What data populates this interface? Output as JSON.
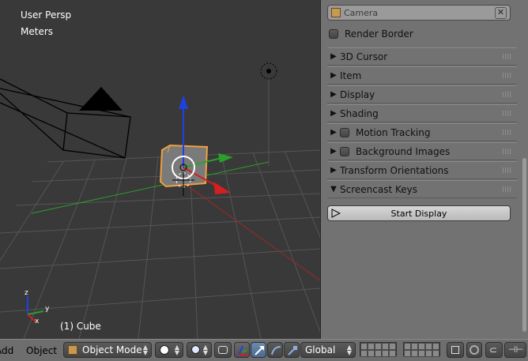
{
  "viewport": {
    "view_name": "User Persp",
    "units": "Meters",
    "object_info": "(1) Cube",
    "axis_labels": {
      "x": "x",
      "y": "y",
      "z": "z"
    }
  },
  "sidebar": {
    "camera_field": {
      "value": "Camera",
      "icon": "camera-cube-icon"
    },
    "render_border_label": "Render Border",
    "panels": [
      {
        "label": "3D Cursor",
        "expanded": false,
        "checkbox": false
      },
      {
        "label": "Item",
        "expanded": false,
        "checkbox": false
      },
      {
        "label": "Display",
        "expanded": false,
        "checkbox": false
      },
      {
        "label": "Shading",
        "expanded": false,
        "checkbox": false
      },
      {
        "label": "Motion Tracking",
        "expanded": false,
        "checkbox": true
      },
      {
        "label": "Background Images",
        "expanded": false,
        "checkbox": true
      },
      {
        "label": "Transform Orientations",
        "expanded": false,
        "checkbox": false
      },
      {
        "label": "Screencast Keys",
        "expanded": true,
        "checkbox": false
      }
    ],
    "start_display_label": "Start Display"
  },
  "header": {
    "add_label": "Add",
    "object_label": "Object",
    "mode_label": "Object Mode",
    "orientation_label": "Global"
  },
  "colors": {
    "viewport_bg": "#393939",
    "sidebar_bg": "#727272",
    "header_bg": "#6e6e6e",
    "selection_orange": "#f0a040",
    "axis_x": "#d02020",
    "axis_y": "#2aa02a",
    "axis_z": "#2040e0"
  }
}
